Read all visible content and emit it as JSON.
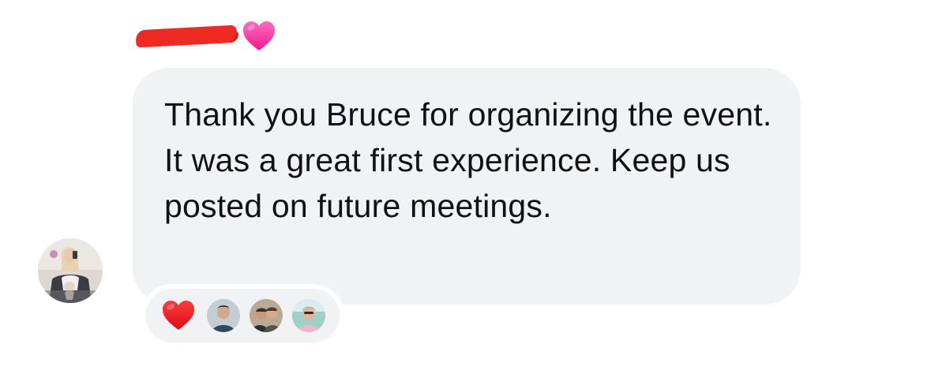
{
  "sender": {
    "name_redacted": true,
    "badge_icon": "pink-heart-icon",
    "badge_color": "#ff3fa6"
  },
  "message": {
    "text": "Thank you Bruce for organizing the event. It was a great first experience. Keep us posted on future meetings."
  },
  "reactions": {
    "emoji_icon": "red-heart-icon",
    "emoji_color": "#e8141f",
    "reactor_avatars": [
      "reactor-avatar-1",
      "reactor-avatar-2",
      "reactor-avatar-3"
    ]
  },
  "colors": {
    "bubble_background": "#f1f2f4",
    "text": "#101114",
    "redaction": "#ee2a24"
  }
}
